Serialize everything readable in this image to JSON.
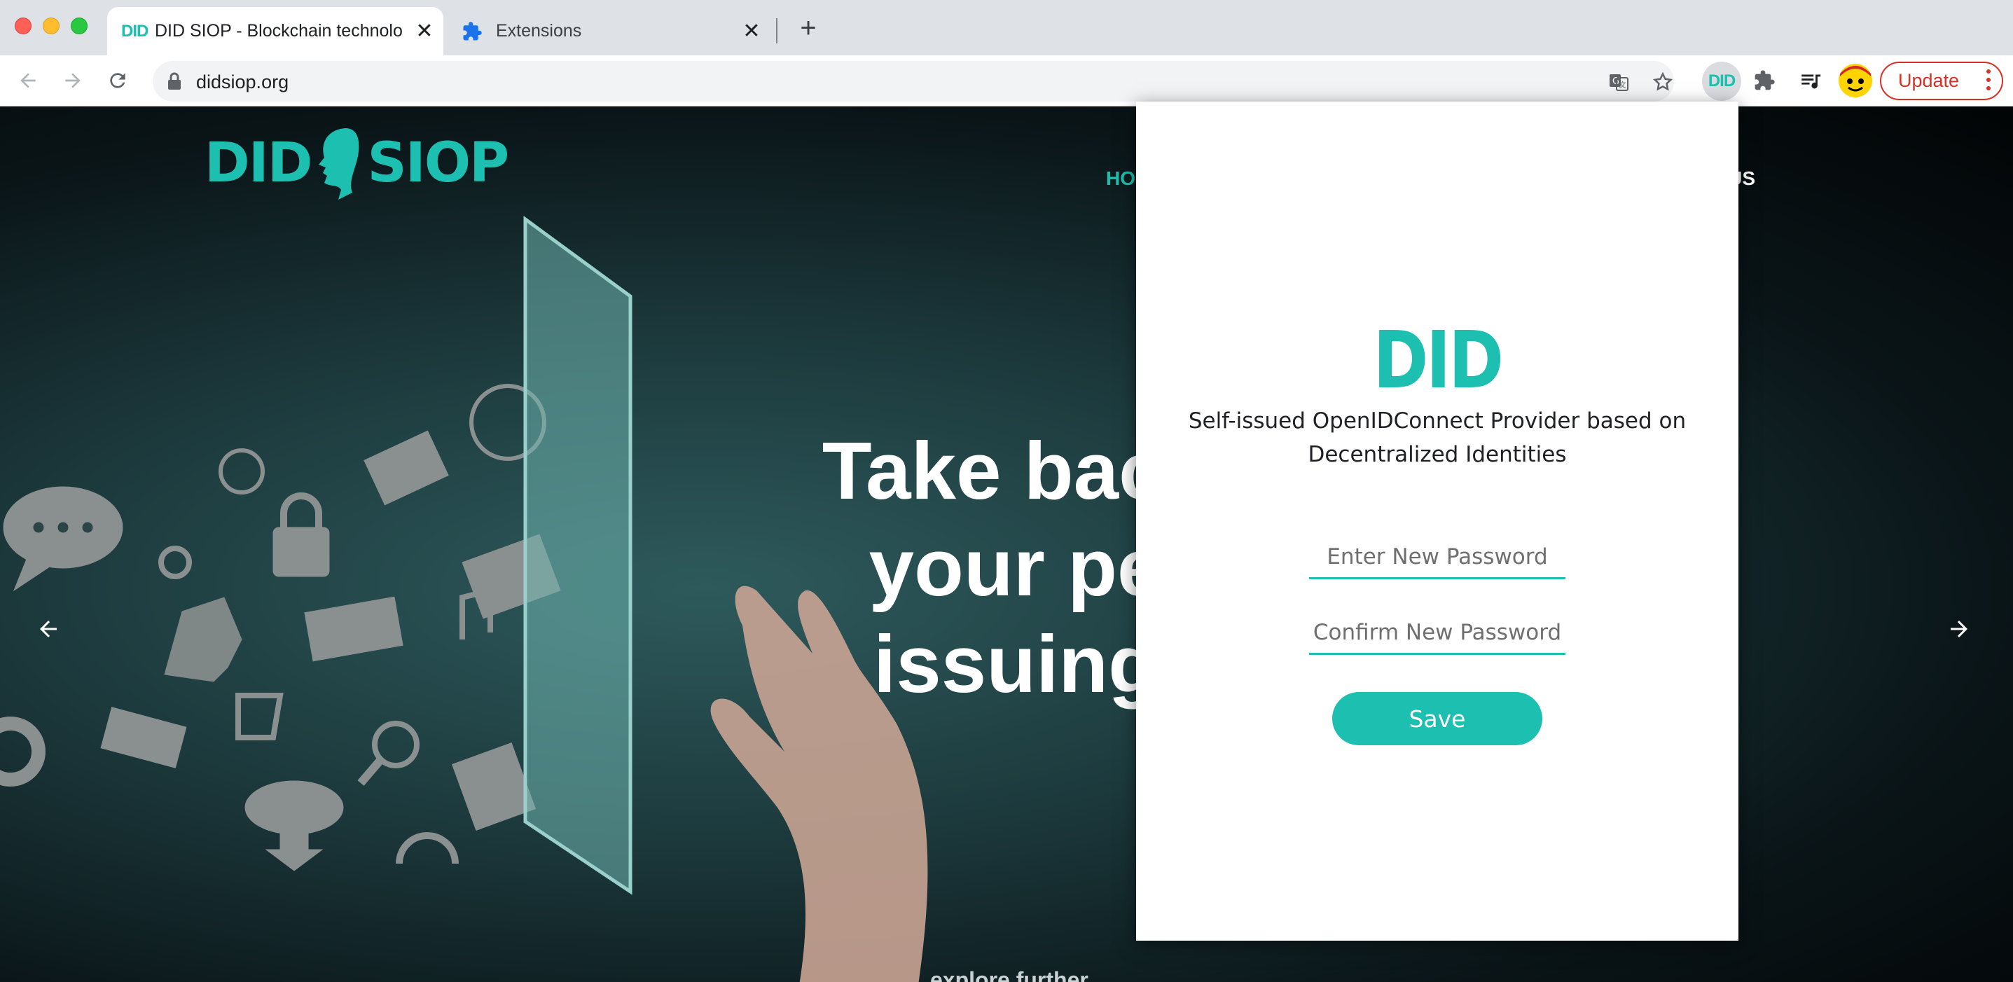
{
  "browser": {
    "tabs": [
      {
        "favicon_text": "DID",
        "title": "DID SIOP - Blockchain technolo",
        "active": true
      },
      {
        "title": "Extensions",
        "active": false
      }
    ],
    "tab_close_glyph": "✕",
    "new_tab_glyph": "+",
    "url": "didsiop.org",
    "extension_label": "DID",
    "update_label": "Update",
    "icons": [
      "back-icon",
      "forward-icon",
      "reload-icon",
      "lock-icon",
      "translate-icon",
      "star-icon",
      "puzzle-icon",
      "media-queue-icon",
      "avatar",
      "more-icon"
    ]
  },
  "site": {
    "logo_left": "DID",
    "logo_right": "SIOP",
    "nav_home": "HO",
    "nav_contact": "CT US",
    "hero_lines": [
      "Take back",
      "your pe",
      "issuing"
    ],
    "explore": "explore further"
  },
  "popup": {
    "logo": "DID",
    "description": "Self-issued OpenIDConnect Provider based on Decentralized Identities",
    "new_password_placeholder": "Enter New Password",
    "new_password_value": "",
    "confirm_password_placeholder": "Confirm New Password",
    "confirm_password_value": "",
    "save_label": "Save"
  },
  "colors": {
    "accent": "#1cbfb0",
    "update": "#d93025"
  }
}
